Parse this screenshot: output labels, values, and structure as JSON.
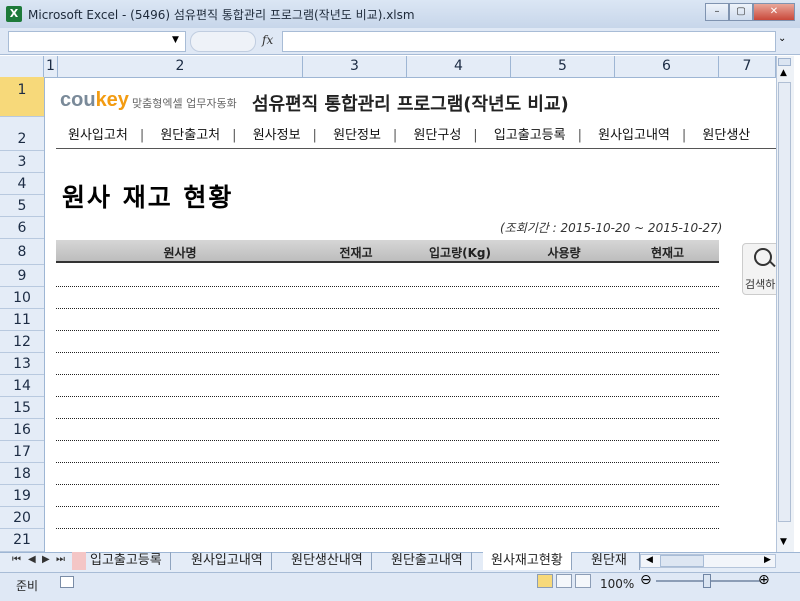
{
  "window": {
    "title": "Microsoft Excel - (5496) 섬유편직 통합관리 프로그램(작년도 비교).xlsm",
    "icon": "excel-icon"
  },
  "formula_bar": {
    "name_box": "",
    "fx_label": "fx",
    "formula": ""
  },
  "columns": [
    "1",
    "2",
    "3",
    "4",
    "5",
    "6",
    "7"
  ],
  "rows": [
    "1",
    "2",
    "3",
    "4",
    "5",
    "6",
    "8",
    "9",
    "10",
    "11",
    "12",
    "13",
    "14",
    "15",
    "16",
    "17",
    "18",
    "19",
    "20",
    "21"
  ],
  "brand": {
    "part1": "cou",
    "part2": "key",
    "tagline": "맞춤형엑셀 업무자동화"
  },
  "program_title": "섬유편직 통합관리 프로그램(작년도 비교)",
  "menu": [
    "원사입고처",
    "원단출고처",
    "원사정보",
    "원단정보",
    "원단구성",
    "입고출고등록",
    "원사입고내역",
    "원단생산"
  ],
  "heading": "원사 재고 현황",
  "period": "(조회기간 : 2015-10-20 ~ 2015-10-27)",
  "table": {
    "headers": [
      "원사명",
      "전재고",
      "입고량(Kg)",
      "사용량",
      "현재고"
    ]
  },
  "search": {
    "label": "검색하"
  },
  "sheet_tabs": [
    "입고출고등록",
    "원사입고내역",
    "원단생산내역",
    "원단출고내역",
    "원사재고현황",
    "원단재"
  ],
  "active_tab": "원사재고현황",
  "status": {
    "ready": "준비",
    "zoom": "100%"
  },
  "colors": {
    "brand_orange": "#f39c12",
    "header_bg": "#e4ecf7"
  }
}
